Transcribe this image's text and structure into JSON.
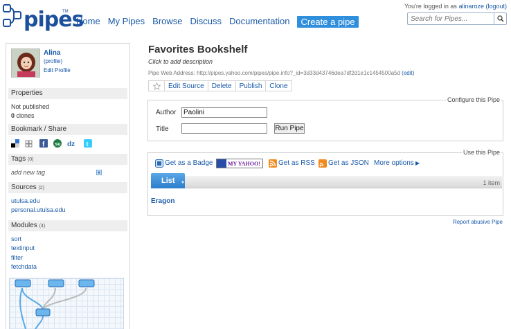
{
  "header": {
    "logo_text": "pipes",
    "logo_tm": "TM",
    "nav": [
      "Home",
      "My Pipes",
      "Browse",
      "Discuss",
      "Documentation"
    ],
    "create_label": "Create a pipe",
    "logged_in_prefix": "You're logged in as ",
    "username": "alinaroze",
    "logout_label": "(logout)",
    "search_placeholder": "Search for Pipes..."
  },
  "sidebar": {
    "user": {
      "name": "Alina",
      "profile_label": "(profile)",
      "edit_label": "Edit Profile"
    },
    "properties": {
      "title": "Properties",
      "status": "Not published",
      "clones_count": "0",
      "clones_label": " clones"
    },
    "bookmark": {
      "title": "Bookmark / Share",
      "icons": [
        "delicious-icon",
        "digg-icon",
        "facebook-icon",
        "stumbleupon-icon",
        "dzone-icon",
        "twitter-icon"
      ]
    },
    "tags": {
      "title": "Tags",
      "count": "(0)",
      "add_placeholder": "add new tag"
    },
    "sources": {
      "title": "Sources",
      "count": "(2)",
      "items": [
        "utulsa.edu",
        "personal.utulsa.edu"
      ]
    },
    "modules": {
      "title": "Modules",
      "count": "(4)",
      "items": [
        "sort",
        "textinput",
        "filter",
        "fetchdata"
      ]
    }
  },
  "pipe": {
    "title": "Favorites Bookshelf",
    "description": "Click to add description",
    "web_address_label": "Pipe Web Address: ",
    "web_address": "http://pipes.yahoo.com/pipes/pipe.info?_id=3d33d43746dea7df2d1e1c1454500a5d",
    "edit_label": "(edit)",
    "toolbar": [
      "Edit Source",
      "Delete",
      "Publish",
      "Clone"
    ]
  },
  "configure": {
    "legend": "Configure this Pipe",
    "author_label": "Author",
    "author_value": "Paolini",
    "title_label": "Title",
    "title_value": "",
    "run_label": "Run Pipe"
  },
  "use": {
    "legend": "Use this Pipe",
    "badge_label": "Get as a Badge",
    "myyahoo_label": "MY YAHOO!",
    "rss_label": "Get as RSS",
    "json_label": "Get as JSON",
    "more_label": "More options"
  },
  "results": {
    "tab_label": "List",
    "count_label": "1 item",
    "items": [
      "Eragon"
    ]
  },
  "report_label": "Report abusive Pipe",
  "colors": {
    "brand": "#1c4f9c",
    "accent": "#2f8fdc",
    "link": "#1a5aa8"
  }
}
